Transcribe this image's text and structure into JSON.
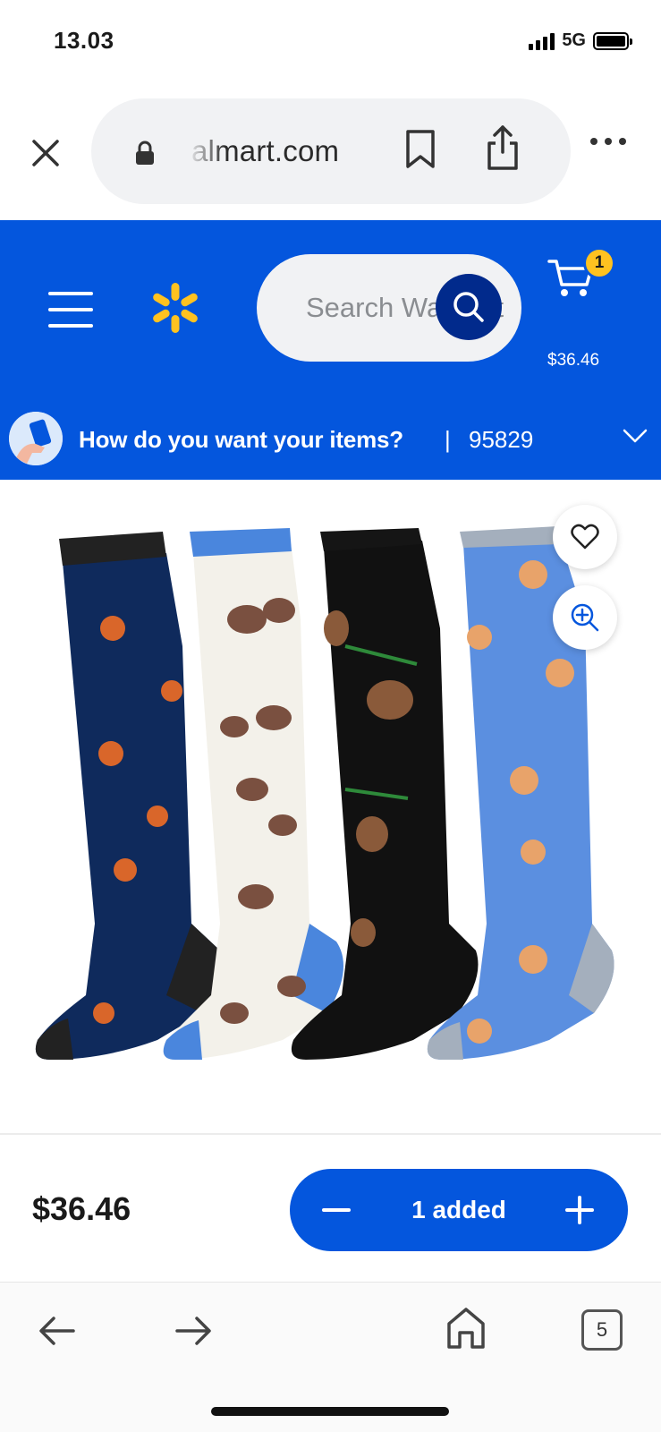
{
  "status_bar": {
    "time": "13.03",
    "network": "5G",
    "icons": [
      "signal-bars-icon",
      "battery-icon"
    ]
  },
  "browser": {
    "url": "almart.com",
    "icons": [
      "close-icon",
      "lock-icon",
      "bookmark-icon",
      "share-icon",
      "more-icon"
    ]
  },
  "header": {
    "search_placeholder": "Search Walmart",
    "cart_count": "1",
    "cart_total": "$36.46",
    "brand_color": "#0456dd",
    "accent_color": "#ffc220",
    "icons": [
      "menu-icon",
      "spark-logo-icon",
      "search-icon",
      "cart-icon"
    ]
  },
  "fulfillment": {
    "prompt": "How do you want your items?",
    "separator": "|",
    "zip": "95829",
    "icons": [
      "store-avatar-icon",
      "chevron-down-icon"
    ]
  },
  "product": {
    "image_desc_icon": "product-socks-image",
    "icons": [
      "heart-icon",
      "zoom-in-icon"
    ]
  },
  "buy_bar": {
    "price": "$36.46",
    "qty_label": "1 added",
    "icons": [
      "minus-icon",
      "plus-icon"
    ]
  },
  "bottom_nav": {
    "tab_count": "5",
    "icons": [
      "back-arrow-icon",
      "forward-arrow-icon",
      "home-icon",
      "tabs-icon"
    ]
  }
}
